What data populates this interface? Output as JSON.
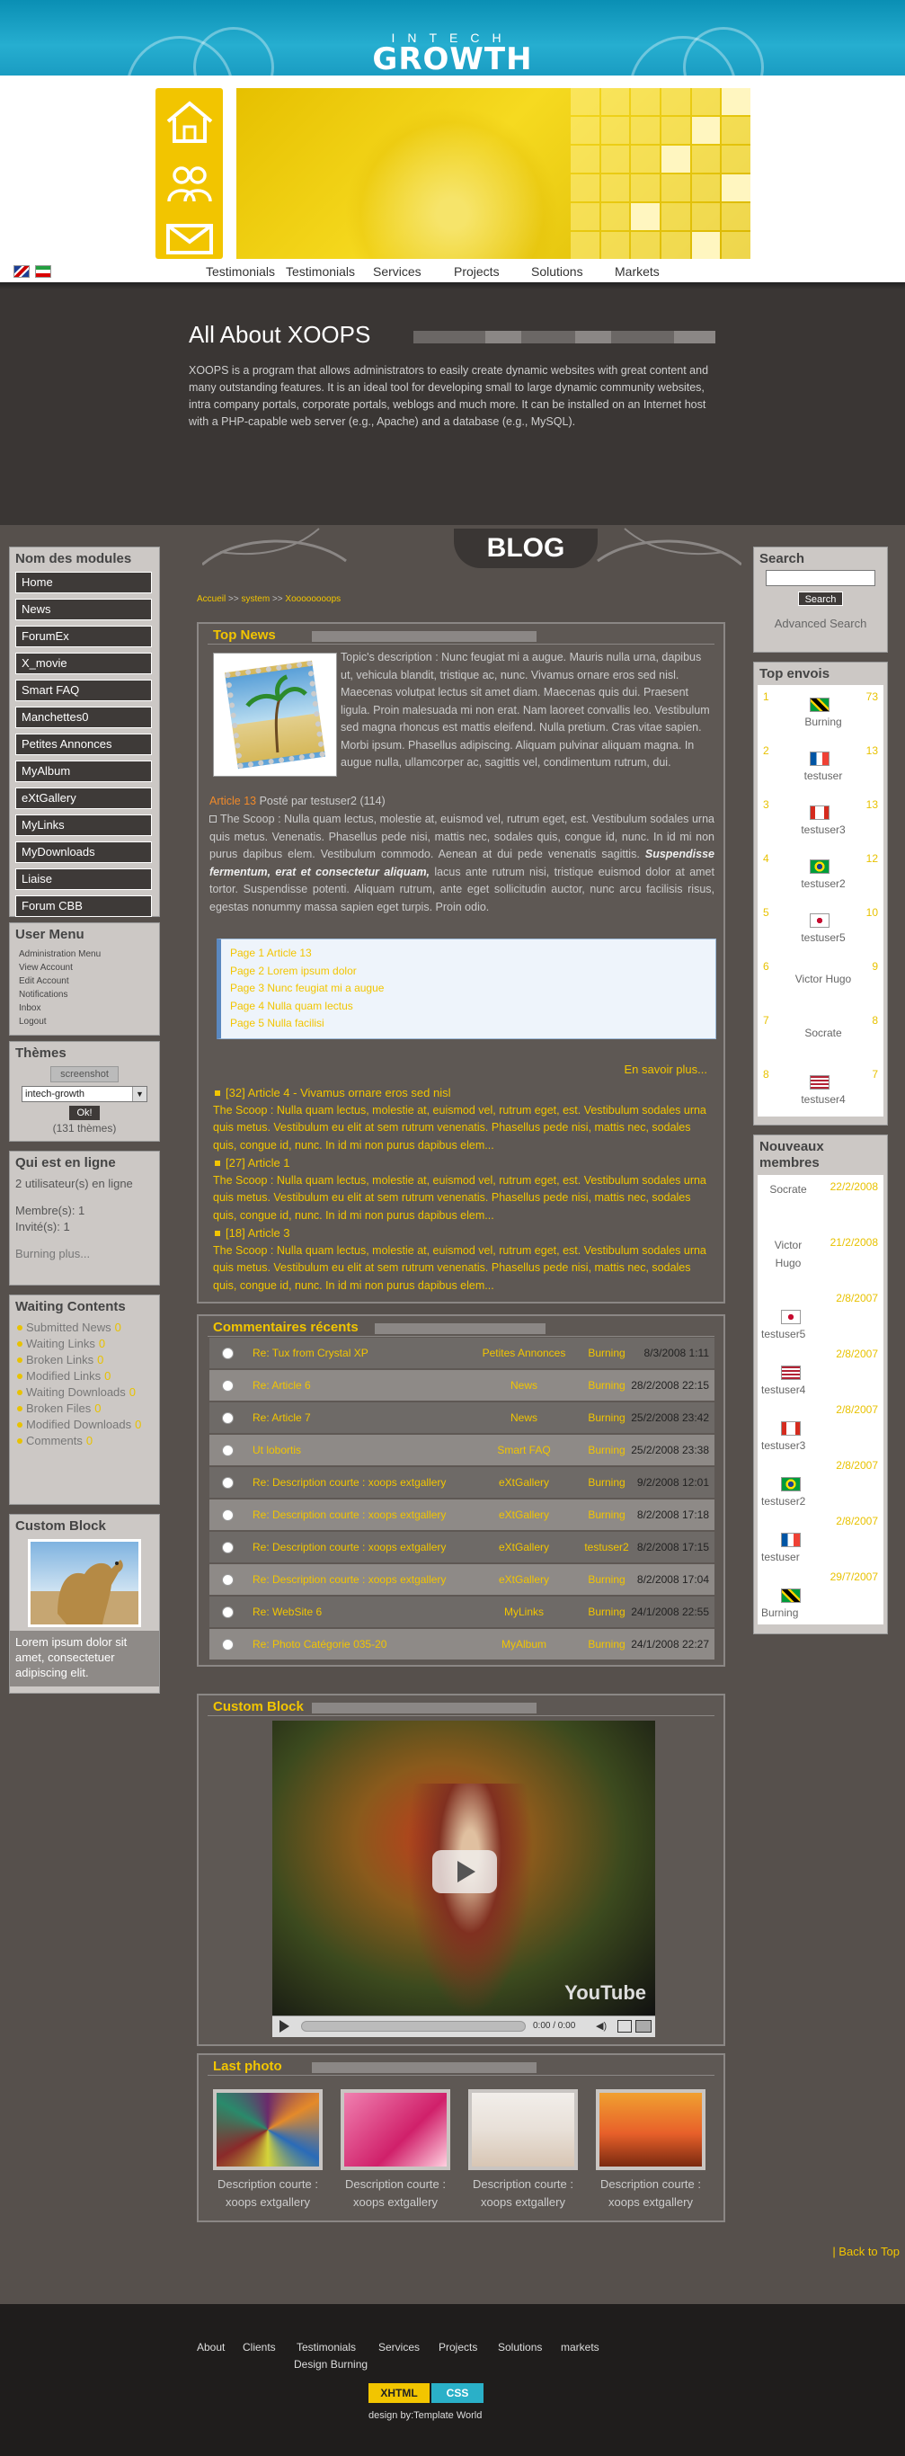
{
  "header": {
    "brand_small": "INTECH",
    "brand_big": "GROWTH",
    "menu": [
      "Testimonials",
      "Testimonials",
      "Services",
      "Projects",
      "Solutions",
      "Markets"
    ]
  },
  "about": {
    "title": "All About XOOPS",
    "text": "XOOPS is a program that allows administrators to easily create dynamic websites with great content and many outstanding features. It is an ideal tool for developing small to large dynamic community websites, intra company portals, corporate portals, weblogs and much more. It can be installed on an Internet host with a PHP-capable web server (e.g., Apache) and a database (e.g., MySQL)."
  },
  "blog_title": "BLOG",
  "breadcrumb": {
    "home": "Accueil",
    "sep": ">>",
    "system": "system",
    "current": "Xoooooooops"
  },
  "modules": {
    "title": "Nom des modules",
    "items": [
      "Home",
      "News",
      "ForumEx",
      "X_movie",
      "Smart FAQ",
      "Manchettes0",
      "Petites Annonces",
      "MyAlbum",
      "eXtGallery",
      "MyLinks",
      "MyDownloads",
      "Liaise",
      "Forum CBB"
    ]
  },
  "usermenu": {
    "title": "User Menu",
    "items": [
      "Administration Menu",
      "View Account",
      "Edit Account",
      "Notifications",
      "Inbox",
      "Logout"
    ]
  },
  "themes": {
    "title": "Thèmes",
    "screenshot": "screenshot",
    "selected": "intech-growth",
    "ok": "Ok!",
    "count": "(131 thèmes)"
  },
  "online": {
    "title": "Qui est en ligne",
    "users": "2 utilisateur(s) en ligne",
    "members": "Membre(s): 1",
    "guests": "Invité(s): 1",
    "who": "Burning  plus..."
  },
  "waiting": {
    "title": "Waiting Contents",
    "items": [
      "Submitted News",
      "Waiting Links",
      "Broken Links",
      "Modified Links",
      "Waiting Downloads",
      "Broken Files",
      "Modified Downloads",
      "Comments"
    ],
    "counts": [
      "0",
      "0",
      "0",
      "0",
      "0",
      "0",
      "0",
      "0"
    ]
  },
  "customleft": {
    "title": "Custom Block",
    "text": "Lorem ipsum dolor sit amet, consectetuer adipiscing elit."
  },
  "search": {
    "title": "Search",
    "button": "Search",
    "advanced": "Advanced Search"
  },
  "topsenders": {
    "title": "Top envois",
    "items": [
      {
        "rank": "1",
        "name": "Burning",
        "count": "73"
      },
      {
        "rank": "2",
        "name": "testuser",
        "count": "13"
      },
      {
        "rank": "3",
        "name": "testuser3",
        "count": "13"
      },
      {
        "rank": "4",
        "name": "testuser2",
        "count": "12"
      },
      {
        "rank": "5",
        "name": "testuser5",
        "count": "10"
      },
      {
        "rank": "6",
        "name": "Victor Hugo",
        "count": "9"
      },
      {
        "rank": "7",
        "name": "Socrate",
        "count": "8"
      },
      {
        "rank": "8",
        "name": "testuser4",
        "count": "7"
      }
    ]
  },
  "newmembers": {
    "title": "Nouveaux membres",
    "items": [
      {
        "name": "Socrate",
        "date": "22/2/2008"
      },
      {
        "name": "Victor Hugo",
        "date": "21/2/2008"
      },
      {
        "name": "testuser5",
        "date": "2/8/2007"
      },
      {
        "name": "testuser4",
        "date": "2/8/2007"
      },
      {
        "name": "testuser3",
        "date": "2/8/2007"
      },
      {
        "name": "testuser2",
        "date": "2/8/2007"
      },
      {
        "name": "testuser",
        "date": "2/8/2007"
      },
      {
        "name": "Burning",
        "date": "29/7/2007"
      }
    ]
  },
  "topnews": {
    "title": "Top News",
    "topic_desc": "Topic's description : Nunc feugiat mi a augue. Mauris nulla urna, dapibus ut, vehicula blandit, tristique ac, nunc. Vivamus ornare eros sed nisl. Maecenas volutpat lectus sit amet diam. Maecenas quis dui. Praesent ligula. Proin malesuada mi non erat. Nam laoreet convallis leo. Vestibulum sed magna rhoncus est mattis eleifend. Nulla pretium. Cras vitae sapien. Morbi ipsum. Phasellus adipiscing. Aliquam pulvinar aliquam magna. In augue nulla, ullamcorper ac, sagittis vel, condimentum rutrum, dui.",
    "article_link": "Article 13",
    "posted": "Posté par testuser2 (114)",
    "scoop": "The Scoop : Nulla quam lectus, molestie at, euismod vel, rutrum eget, est. Vestibulum sodales urna quis metus. Venenatis. Phasellus pede nisi, mattis nec, sodales quis, congue id, nunc. In id mi non purus dapibus elem. Vestibulum commodo. Aenean at dui pede venenatis sagittis.",
    "scoop_bold": "Suspendisse fermentum, erat et consectetur aliquam,",
    "scoop_end": "lacus ante rutrum nisi, tristique euismod dolor at amet tortor. Suspendisse potenti. Aliquam rutrum, ante eget sollicitudin auctor, nunc arcu facilisis risus, egestas nonummy massa sapien eget turpis. Proin odio.",
    "pages": [
      "Page 1 Article 13",
      "Page 2 Lorem ipsum dolor",
      "Page 3 Nunc feugiat mi a augue",
      "Page 4 Nulla quam lectus",
      "Page 5 Nulla facilisi"
    ],
    "more": "En savoir plus...",
    "list": [
      {
        "head": "[32] Article 4 - Vivamus ornare eros sed nisl",
        "body": "The Scoop : Nulla quam lectus, molestie at, euismod vel, rutrum eget, est. Vestibulum sodales urna quis metus. Vestibulum eu elit at sem rutrum venenatis. Phasellus pede nisi, mattis nec, sodales quis, congue id, nunc. In id mi non purus dapibus elem..."
      },
      {
        "head": "[27] Article 1",
        "body": "The Scoop : Nulla quam lectus, molestie at, euismod vel, rutrum eget, est. Vestibulum sodales urna quis metus. Vestibulum eu elit at sem rutrum venenatis. Phasellus pede nisi, mattis nec, sodales quis, congue id, nunc. In id mi non purus dapibus elem..."
      },
      {
        "head": "[18] Article 3",
        "body": "The Scoop : Nulla quam lectus, molestie at, euismod vel, rutrum eget, est. Vestibulum sodales urna quis metus. Vestibulum eu elit at sem rutrum venenatis. Phasellus pede nisi, mattis nec, sodales quis, congue id, nunc. In id mi non purus dapibus elem..."
      }
    ]
  },
  "comments": {
    "title": "Commentaires récents",
    "rows": [
      {
        "title": "Re: Tux from Crystal XP",
        "module": "Petites Annonces",
        "user": "Burning",
        "date": "8/3/2008 1:11"
      },
      {
        "title": "Re: Article 6",
        "module": "News",
        "user": "Burning",
        "date": "28/2/2008 22:15"
      },
      {
        "title": "Re: Article 7",
        "module": "News",
        "user": "Burning",
        "date": "25/2/2008 23:42"
      },
      {
        "title": "Ut lobortis",
        "module": "Smart FAQ",
        "user": "Burning",
        "date": "25/2/2008 23:38"
      },
      {
        "title": "Re: Description courte : xoops extgallery",
        "module": "eXtGallery",
        "user": "Burning",
        "date": "9/2/2008 12:01"
      },
      {
        "title": "Re: Description courte : xoops extgallery",
        "module": "eXtGallery",
        "user": "Burning",
        "date": "8/2/2008 17:18"
      },
      {
        "title": "Re: Description courte : xoops extgallery",
        "module": "eXtGallery",
        "user": "testuser2",
        "date": "8/2/2008 17:15"
      },
      {
        "title": "Re: Description courte : xoops extgallery",
        "module": "eXtGallery",
        "user": "Burning",
        "date": "8/2/2008 17:04"
      },
      {
        "title": "Re: WebSite 6",
        "module": "MyLinks",
        "user": "Burning",
        "date": "24/1/2008 22:55"
      },
      {
        "title": "Re: Photo Catégorie 035-20",
        "module": "MyAlbum",
        "user": "Burning",
        "date": "24/1/2008 22:27"
      }
    ]
  },
  "customcenter": {
    "title": "Custom Block",
    "time": "0:00 / 0:00",
    "logo": "YouTube"
  },
  "lastphoto": {
    "title": "Last photo",
    "caption": "Description courte : xoops extgallery"
  },
  "back_to_top": "| Back to Top",
  "footer": {
    "links": [
      "About",
      "Clients",
      "Testimonials",
      "Services",
      "Projects",
      "Solutions",
      "markets"
    ],
    "design": "Design Burning",
    "xhtml": "XHTML",
    "css": "CSS",
    "credit": "design by:Template World"
  },
  "colors": {
    "accent": "#f2c500",
    "header": "#1a9cc2",
    "dark": "#3a3634",
    "bg": "#56504c"
  }
}
